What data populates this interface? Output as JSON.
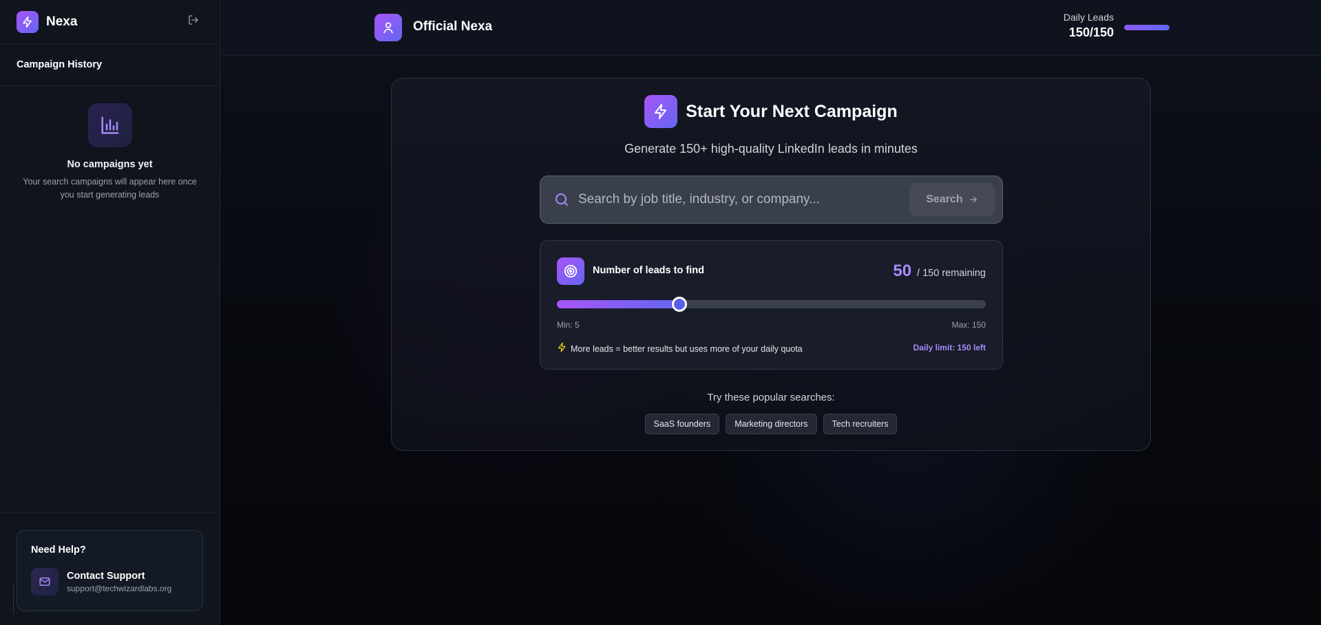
{
  "sidebar": {
    "brand_name": "Nexa",
    "section_title": "Campaign History",
    "empty_title": "No campaigns yet",
    "empty_description": "Your search campaigns will appear here once you start generating leads",
    "help_title": "Need Help?",
    "support_title": "Contact Support",
    "support_email": "support@techwizardlabs.org",
    "icons": [
      "bolt-icon",
      "logout-icon",
      "bar-chart-icon",
      "mail-icon"
    ]
  },
  "header": {
    "title": "Official Nexa",
    "daily_leads_label": "Daily Leads",
    "daily_leads_value": "150/150",
    "daily_leads_progress": 1.0
  },
  "campaign": {
    "title": "Start Your Next Campaign",
    "subtitle": "Generate 150+ high-quality LinkedIn leads in minutes",
    "search_placeholder": "Search by job title, industry, or company...",
    "search_value": "",
    "search_button": "Search",
    "leads": {
      "label": "Number of leads to find",
      "value": "50",
      "remaining_text": "/ 150 remaining",
      "slider_value": 50,
      "slider_min": 5,
      "slider_max": 150,
      "min_label": "Min: 5",
      "max_label": "Max: 150",
      "tip": "More leads = better results but uses more of your daily quota",
      "daily_limit": "Daily limit: 150 left"
    },
    "popular_label": "Try these popular searches:",
    "popular_searches": [
      "SaaS founders",
      "Marketing directors",
      "Tech recruiters"
    ]
  },
  "colors": {
    "accent_purple": "#a855f7",
    "accent_indigo": "#6366f1",
    "highlight_text": "#a78bfa",
    "tip_icon": "#facc15"
  }
}
